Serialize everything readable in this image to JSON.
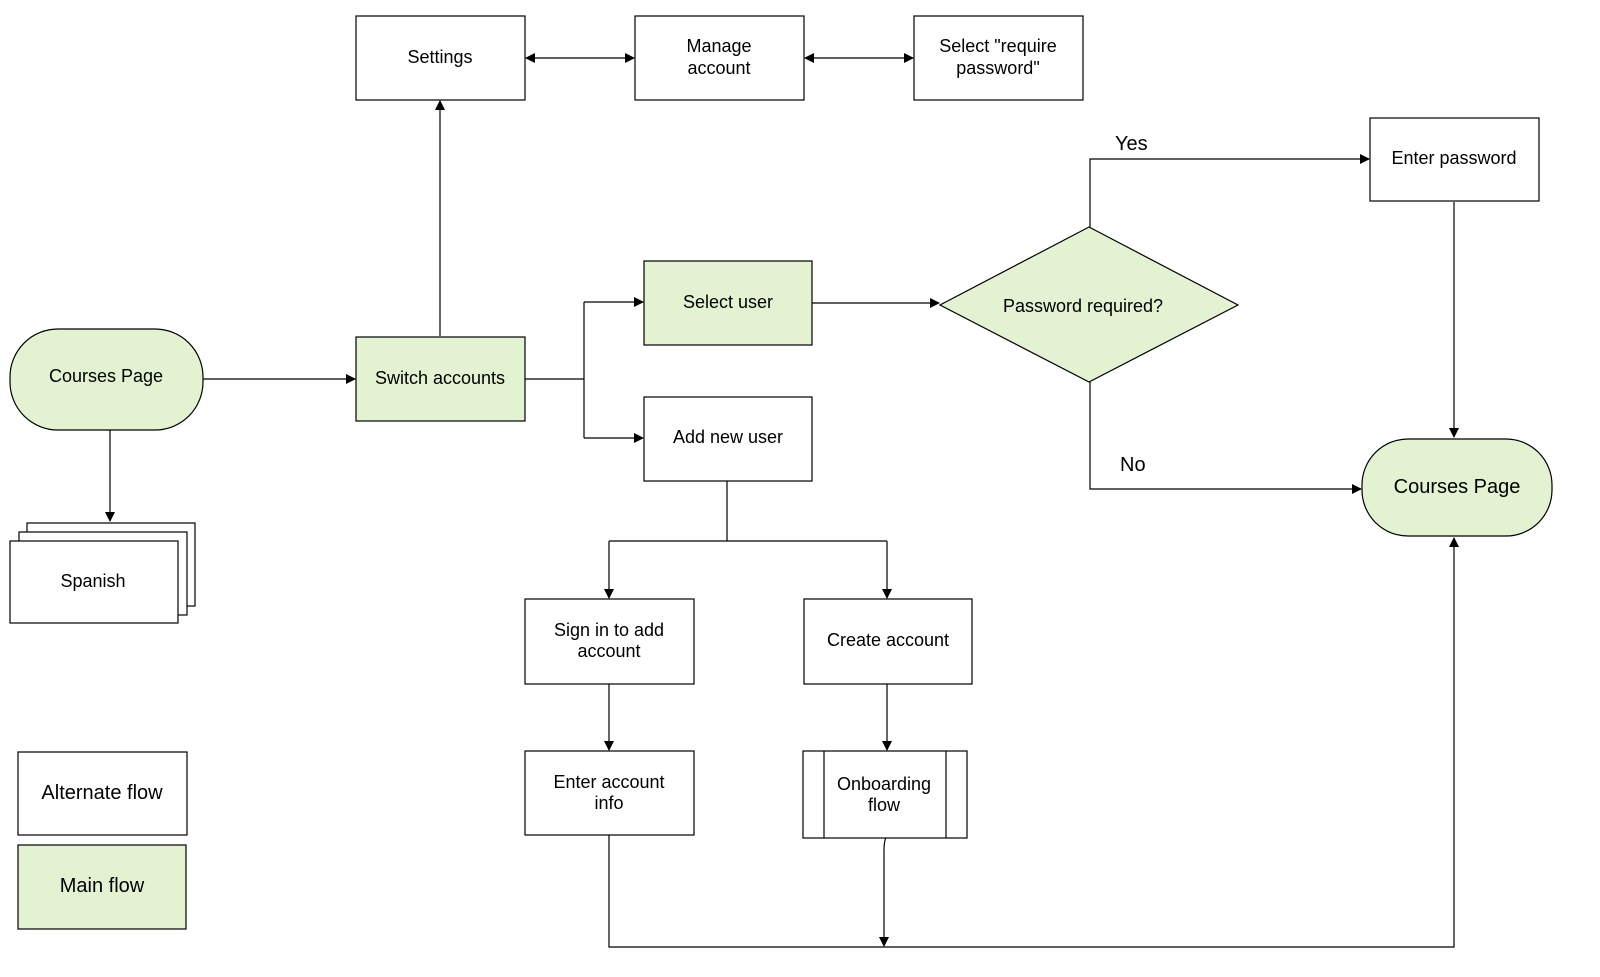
{
  "colors": {
    "main": "#e3f2d0",
    "alternate": "#ffffff",
    "stroke": "#000000"
  },
  "nodes": {
    "courses_left": {
      "label": "Courses Page",
      "type": "terminal",
      "flow": "main"
    },
    "spanish": {
      "label": "Spanish",
      "type": "multi-document",
      "flow": "alternate"
    },
    "switch_accounts": {
      "label": "Switch accounts",
      "type": "process",
      "flow": "main"
    },
    "settings": {
      "label": "Settings",
      "type": "process",
      "flow": "alternate"
    },
    "manage_account": {
      "lines": [
        "Manage",
        "account"
      ],
      "type": "process",
      "flow": "alternate"
    },
    "require_password": {
      "lines": [
        "Select \"require",
        "password\""
      ],
      "type": "process",
      "flow": "alternate"
    },
    "select_user": {
      "label": "Select user",
      "type": "process",
      "flow": "main"
    },
    "add_new_user": {
      "label": "Add new user",
      "type": "process",
      "flow": "alternate"
    },
    "password_required": {
      "label": "Password required?",
      "type": "decision",
      "flow": "main"
    },
    "enter_password": {
      "label": "Enter password",
      "type": "process",
      "flow": "alternate"
    },
    "courses_right": {
      "label": "Courses Page",
      "type": "terminal",
      "flow": "main"
    },
    "sign_in": {
      "lines": [
        "Sign in to add",
        "account"
      ],
      "type": "process",
      "flow": "alternate"
    },
    "create_account": {
      "label": "Create account",
      "type": "process",
      "flow": "alternate"
    },
    "enter_account_info": {
      "lines": [
        "Enter account",
        "info"
      ],
      "type": "process",
      "flow": "alternate"
    },
    "onboarding": {
      "lines": [
        "Onboarding",
        "flow"
      ],
      "type": "predefined-process",
      "flow": "alternate"
    }
  },
  "edge_labels": {
    "yes": "Yes",
    "no": "No"
  },
  "legend": {
    "alternate": "Alternate flow",
    "main": "Main flow"
  }
}
